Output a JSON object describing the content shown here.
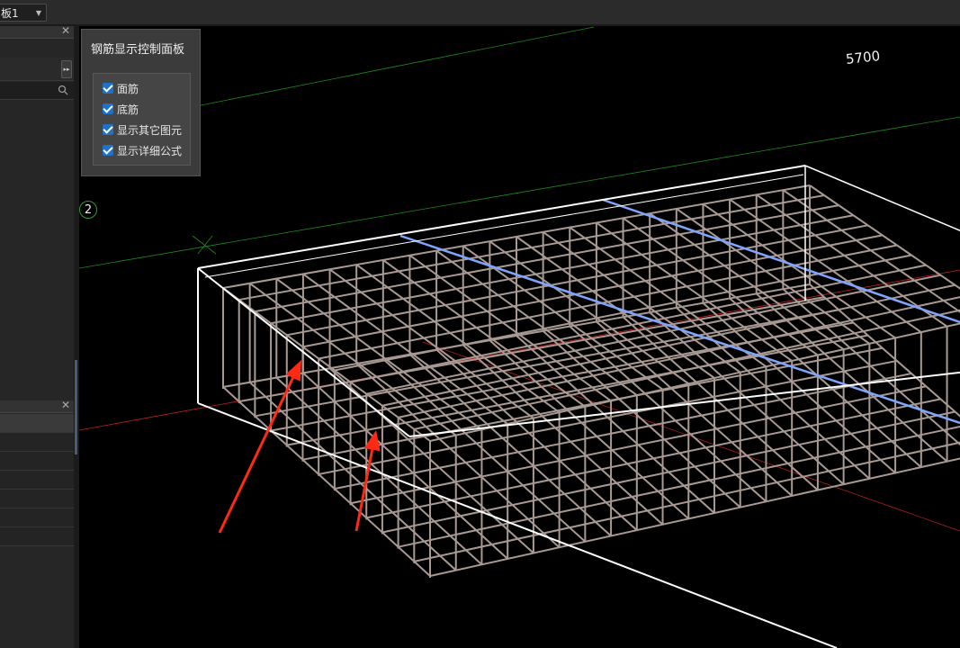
{
  "toolbar": {
    "combo_value": "板1"
  },
  "control_panel": {
    "title": "钢筋显示控制面板",
    "options": [
      {
        "label": "面筋",
        "checked": true
      },
      {
        "label": "底筋",
        "checked": true
      },
      {
        "label": "显示其它图元",
        "checked": true
      },
      {
        "label": "显示详细公式",
        "checked": true
      }
    ]
  },
  "viewport": {
    "axis_label": "2",
    "dimension_label": "5700"
  },
  "colors": {
    "rebar": "#a89a93",
    "slab_edge": "#ffffff",
    "highlight_bar": "#7fa6ff",
    "axis_green": "#1c8a1c",
    "axis_red": "#c81e1e",
    "annotation_arrow": "#ff2a14",
    "checkbox": "#1e73c8"
  }
}
